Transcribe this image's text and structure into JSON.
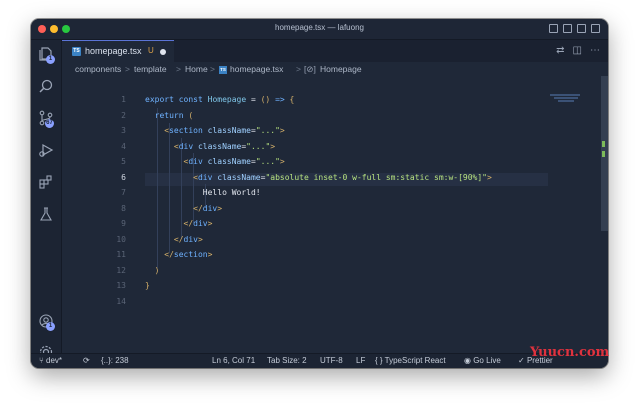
{
  "window": {
    "title": "homepage.tsx — lafuong"
  },
  "activity_bar": {
    "badges": {
      "explorer": "1",
      "source_control": "67",
      "accounts": "1"
    },
    "icons": [
      "files-icon",
      "search-icon",
      "source-control-icon",
      "run-debug-icon",
      "extensions-icon",
      "flask-icon",
      "account-icon",
      "gear-icon"
    ]
  },
  "tab": {
    "filename": "homepage.tsx",
    "icon_text": "TS",
    "status": "U"
  },
  "breadcrumb": {
    "items": [
      "components",
      "template",
      "Home",
      "homepage.tsx",
      "Homepage"
    ],
    "separator": ">",
    "symbol_prefix": "[⊘]"
  },
  "editor": {
    "line_numbers": [
      "1",
      "2",
      "3",
      "4",
      "5",
      "6",
      "7",
      "8",
      "9",
      "10",
      "11",
      "12",
      "13",
      "14"
    ],
    "active_line": "6",
    "lines": [
      {
        "n": 1,
        "segments": [
          [
            "kw",
            "export const "
          ],
          [
            "fn",
            "Homepage"
          ],
          [
            "txt",
            " = "
          ],
          [
            "pun",
            "() "
          ],
          [
            "kw",
            "=> "
          ],
          [
            "pun",
            "{"
          ]
        ]
      },
      {
        "n": 2,
        "segments": [
          [
            "kw",
            "  return "
          ],
          [
            "pun",
            "("
          ]
        ]
      },
      {
        "n": 3,
        "segments": [
          [
            "pun",
            "    <"
          ],
          [
            "tag",
            "section "
          ],
          [
            "attr",
            "className"
          ],
          [
            "txt",
            "="
          ],
          [
            "str",
            "\"...\""
          ],
          [
            "pun",
            ">"
          ]
        ]
      },
      {
        "n": 4,
        "segments": [
          [
            "pun",
            "      <"
          ],
          [
            "tag",
            "div "
          ],
          [
            "attr",
            "className"
          ],
          [
            "txt",
            "="
          ],
          [
            "str",
            "\"...\""
          ],
          [
            "pun",
            ">"
          ]
        ]
      },
      {
        "n": 5,
        "segments": [
          [
            "pun",
            "        <"
          ],
          [
            "tag",
            "div "
          ],
          [
            "attr",
            "className"
          ],
          [
            "txt",
            "="
          ],
          [
            "str",
            "\"...\""
          ],
          [
            "pun",
            ">"
          ]
        ]
      },
      {
        "n": 6,
        "segments": [
          [
            "pun",
            "          <"
          ],
          [
            "tag",
            "div "
          ],
          [
            "attr",
            "className"
          ],
          [
            "txt",
            "="
          ],
          [
            "str",
            "\"absolute inset-0 w-full sm:static sm:w-[90%]\""
          ],
          [
            "pun",
            ">"
          ]
        ]
      },
      {
        "n": 7,
        "segments": [
          [
            "txt",
            "            Hello World!"
          ]
        ]
      },
      {
        "n": 8,
        "segments": [
          [
            "pun",
            "          </"
          ],
          [
            "tag",
            "div"
          ],
          [
            "pun",
            ">"
          ]
        ]
      },
      {
        "n": 9,
        "segments": [
          [
            "pun",
            "        </"
          ],
          [
            "tag",
            "div"
          ],
          [
            "pun",
            ">"
          ]
        ]
      },
      {
        "n": 10,
        "segments": [
          [
            "pun",
            "      </"
          ],
          [
            "tag",
            "div"
          ],
          [
            "pun",
            ">"
          ]
        ]
      },
      {
        "n": 11,
        "segments": [
          [
            "pun",
            "    </"
          ],
          [
            "tag",
            "section"
          ],
          [
            "pun",
            ">"
          ]
        ]
      },
      {
        "n": 12,
        "segments": [
          [
            "pun",
            "  )"
          ]
        ]
      },
      {
        "n": 13,
        "segments": [
          [
            "pun",
            "}"
          ]
        ]
      },
      {
        "n": 14,
        "segments": []
      }
    ]
  },
  "status_bar": {
    "branch": "dev*",
    "sync": "{..}: 238",
    "position": "Ln 6, Col 71",
    "tab_size": "Tab Size: 2",
    "encoding": "UTF-8",
    "eol": "LF",
    "language": "TypeScript React",
    "golive": "Go Live",
    "prettier": "Prettier"
  },
  "watermark": "Yuucn.com",
  "colors": {
    "accent": "#5b74d6",
    "background": "#1f2838",
    "watermark": "#e0323e"
  }
}
